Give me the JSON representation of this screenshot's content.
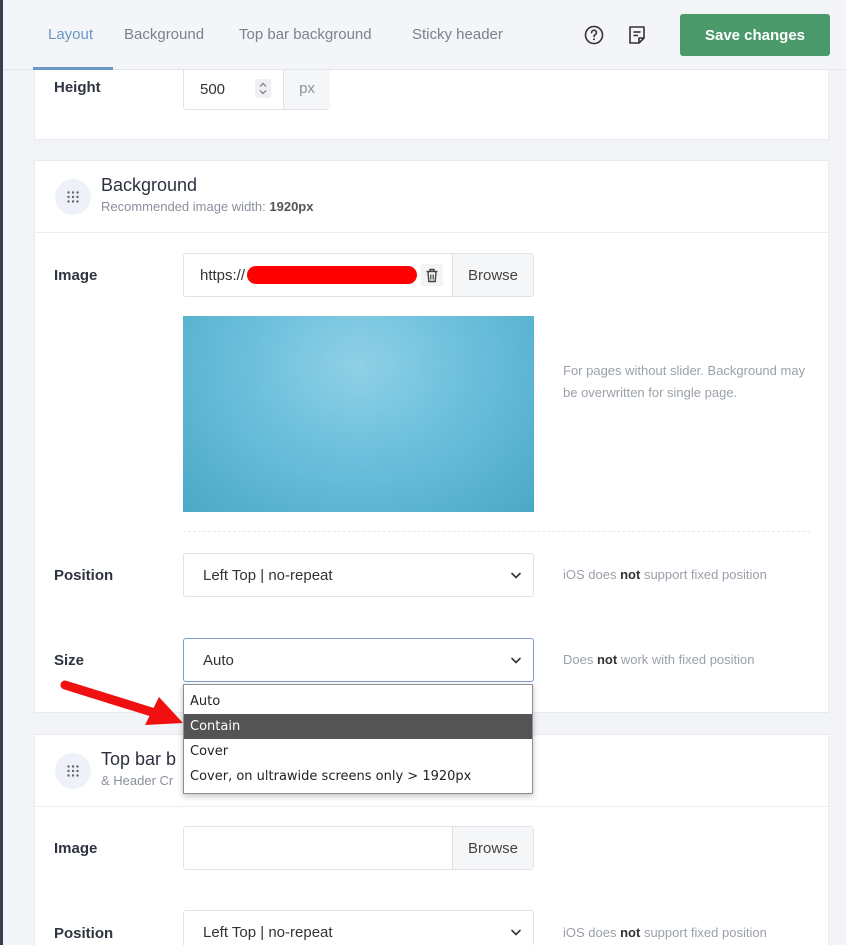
{
  "tabs": [
    {
      "label": "Layout",
      "active": true
    },
    {
      "label": "Background",
      "active": false
    },
    {
      "label": "Top bar background",
      "active": false
    },
    {
      "label": "Sticky header",
      "active": false
    }
  ],
  "toolbar": {
    "help_icon": "question-circle-icon",
    "notes_icon": "notes-icon",
    "save_label": "Save changes",
    "save_color": "#4b9a6b",
    "accent_color": "#6a98c4"
  },
  "height_section": {
    "label": "Height",
    "value": "500",
    "unit": "px"
  },
  "background_section": {
    "title": "Background",
    "subtitle_prefix": "Recommended image width:",
    "subtitle_value": "1920px",
    "image_label": "Image",
    "image_url": "https://",
    "browse_label": "Browse",
    "image_hint": "For pages without slider. Background may be overwritten for single page.",
    "preview_color": "#5db6d3",
    "position_label": "Position",
    "position_value": "Left Top | no-repeat",
    "position_hint_a": "iOS does",
    "position_hint_b": "not",
    "position_hint_c": "support fixed position",
    "size_label": "Size",
    "size_value": "Auto",
    "size_hint_a": "Does",
    "size_hint_b": "not",
    "size_hint_c": "work with fixed position"
  },
  "size_dropdown": {
    "options": [
      "Auto",
      "Contain",
      "Cover",
      "Cover, on ultrawide screens only > 1920px"
    ],
    "highlighted": "Contain"
  },
  "topbar_section": {
    "title": "Top bar b",
    "subtitle": "& Header Cr",
    "image_label": "Image",
    "image_url": "",
    "browse_label": "Browse",
    "position_label": "Position",
    "position_value": "Left Top | no-repeat",
    "position_hint_a": "iOS does",
    "position_hint_b": "not",
    "position_hint_c": "support fixed position"
  }
}
